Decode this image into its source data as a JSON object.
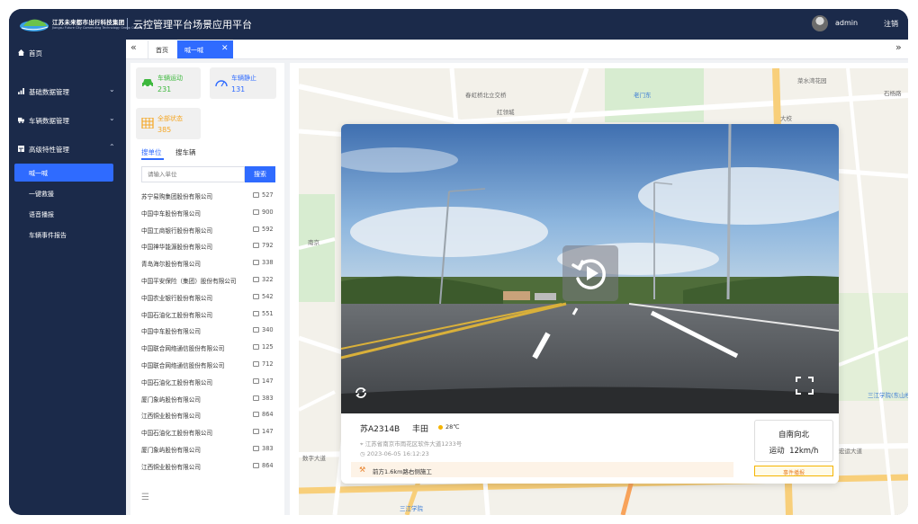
{
  "header": {
    "company_name": "江苏未来都市出行科技集团",
    "company_sub": "Jiangsu Future City Commuting Technology Group Co.,Ltd",
    "platform_title": "云控管理平台场景应用平台",
    "user": "admin",
    "logout": "注销"
  },
  "sidebar": {
    "items": [
      {
        "label": "首页",
        "icon": "home-icon"
      },
      {
        "label": "基础数据管理",
        "icon": "bar-chart-icon"
      },
      {
        "label": "车辆数据管理",
        "icon": "truck-icon"
      },
      {
        "label": "高级特性管理",
        "icon": "table-icon"
      }
    ],
    "subitems": [
      "喊一喊",
      "一键救援",
      "语音播报",
      "车辆事件报告"
    ]
  },
  "tabs": {
    "home": "首页",
    "active": "喊一喊"
  },
  "stats": [
    {
      "name": "车辆运动",
      "value": "231",
      "color": "#3db83d"
    },
    {
      "name": "车辆静止",
      "value": "131",
      "color": "#2f6bff"
    },
    {
      "name": "全部状态",
      "value": "385",
      "color": "#f5a623"
    }
  ],
  "search": {
    "tab_unit": "搜单位",
    "tab_vehicle": "搜车辆",
    "placeholder": "请输入单位",
    "button": "搜索"
  },
  "orgs": [
    {
      "name": "苏宁易购集团股份有限公司",
      "count": "527"
    },
    {
      "name": "中国中车股份有限公司",
      "count": "900"
    },
    {
      "name": "中国工商银行股份有限公司",
      "count": "592"
    },
    {
      "name": "中国神华能源股份有限公司",
      "count": "792"
    },
    {
      "name": "青岛海尔股份有限公司",
      "count": "338"
    },
    {
      "name": "中国平安保险（集团）股份有限公司",
      "count": "322"
    },
    {
      "name": "中国农业银行股份有限公司",
      "count": "542"
    },
    {
      "name": "中国石油化工股份有限公司",
      "count": "551"
    },
    {
      "name": "中国中车股份有限公司",
      "count": "340"
    },
    {
      "name": "中国联合网络通信股份有限公司",
      "count": "125"
    },
    {
      "name": "中国联合网络通信股份有限公司",
      "count": "712"
    },
    {
      "name": "中国石油化工股份有限公司",
      "count": "147"
    },
    {
      "name": "厦门象屿股份有限公司",
      "count": "383"
    },
    {
      "name": "江西铜业股份有限公司",
      "count": "864"
    },
    {
      "name": "中国石油化工股份有限公司",
      "count": "147"
    },
    {
      "name": "厦门象屿股份有限公司",
      "count": "383"
    },
    {
      "name": "江西铜业股份有限公司",
      "count": "864"
    }
  ],
  "map_labels": {
    "l1": "春虹桥北立交桥",
    "l2": "红领城",
    "l3": "老门东",
    "l4": "菜水湾花园",
    "l5": "石杨路",
    "l6": "南京",
    "l7": "三江学院(东山校区)",
    "l8": "数字大道",
    "l9": "宏运大道",
    "l10": "三江学院",
    "l11": "大校"
  },
  "vehicle": {
    "plate": "苏A2314B",
    "brand": "丰田",
    "weather": "28℃",
    "address": "江苏省南京市雨花区软件大道1233号",
    "time": "2023-06-05 16:12:23",
    "alert": "前方1.6km路右侧施工",
    "direction": "自南向北",
    "status": "运动",
    "speed": "12km/h",
    "warn_button": "事件播报"
  }
}
